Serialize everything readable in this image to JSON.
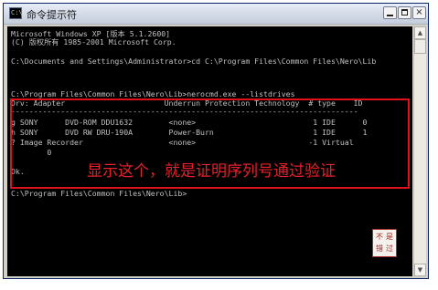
{
  "window": {
    "title": "命令提示符",
    "icon": "C:\\",
    "minimize_icon": "minimize-icon",
    "maximize_icon": "maximize-icon",
    "close_label": "×"
  },
  "console": {
    "lines": [
      "Microsoft Windows XP [版本 5.1.2600]",
      "(C) 版权所有 1985-2001 Microsoft Corp.",
      "",
      "C:\\Documents and Settings\\Administrator>cd C:\\Program Files\\Common Files\\Nero\\Lib",
      "",
      "",
      "C:\\Program Files\\Common Files\\Nero\\Lib>nerocmd.exe --listdrives",
      "Drv: Adapter                      Underrun Protection Technology  # type    ID",
      "-----------------------------------------------------------------------------",
      "g SONY      DVD-ROM DDU1632        <none>                          1 IDE      0",
      "h SONY      DVD RW DRU-190A        Power-Burn                      1 IDE      1",
      "? Image Recorder                   <none>                         -1 Virtual",
      "        0",
      "",
      "Ok.",
      "",
      "C:\\Program Files\\Common Files\\Nero\\Lib>"
    ]
  },
  "annotation": {
    "text": "显示这个，就是证明序列号通过验证",
    "color": "#e8202a"
  },
  "seal": {
    "chars": [
      "不",
      "是",
      "错",
      "过"
    ],
    "color": "#a02823"
  },
  "scrollbar": {
    "up_arrow": "▲",
    "down_arrow": "▼"
  }
}
